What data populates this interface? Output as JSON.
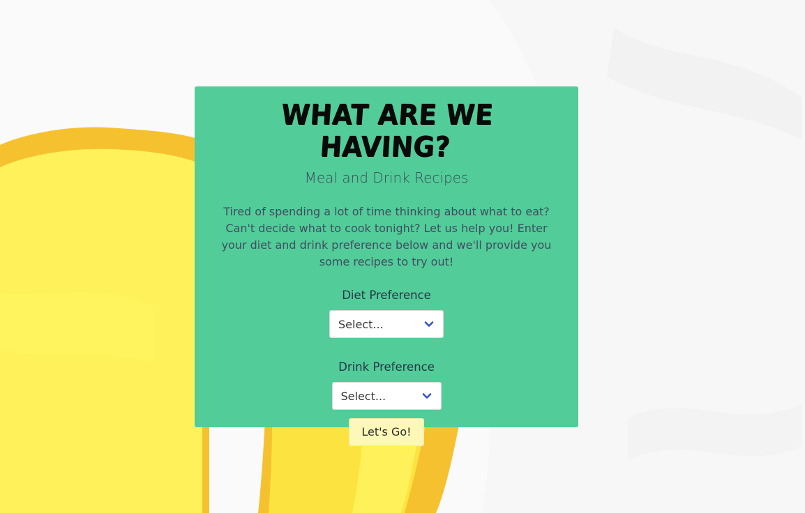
{
  "hero": {
    "title": "What Are We Having?",
    "subtitle": "Meal and Drink Recipes",
    "description": "Tired of spending a lot of time thinking about what to eat? Can't decide what to cook tonight? Let us help you! Enter your diet and drink preference below and we'll provide you some recipes to try out!"
  },
  "form": {
    "diet_label": "Diet Preference",
    "diet_selected": "Select...",
    "drink_label": "Drink Preference",
    "drink_selected": "Select...",
    "submit_label": "Let's Go!"
  },
  "icons": {
    "dropdown": "chevron-down-icon"
  },
  "colors": {
    "card_background": "#52cc98",
    "button_background": "#fdf7b8",
    "chevron": "#3850c8",
    "paint_yellow": "#fff15a",
    "paint_orange": "#f6c12f"
  }
}
